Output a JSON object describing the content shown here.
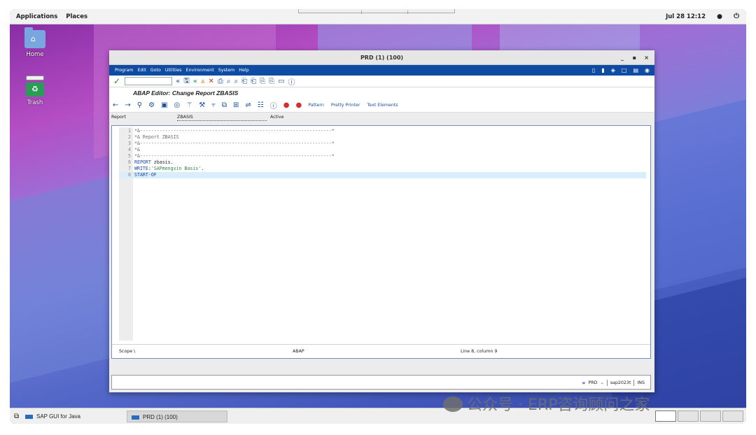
{
  "topbar": {
    "applications": "Applications",
    "places": "Places",
    "clock": "Jul 28 12:12",
    "dot": "●",
    "power": "⏻"
  },
  "desktop": {
    "home_label": "Home",
    "trash_label": "Trash"
  },
  "window": {
    "title": "PRD (1) (100)",
    "controls": {
      "minimize": "_",
      "maximize": "▪",
      "close": "×"
    },
    "menu": [
      "Program",
      "Edit",
      "Goto",
      "Utilities",
      "Environment",
      "System",
      "Help"
    ],
    "heading": "ABAP Editor: Change Report ZBASIS",
    "toolbar_text_buttons": {
      "pattern": "Pattern",
      "pretty_printer": "Pretty Printer",
      "text_elements": "Text Elements"
    },
    "report_row": {
      "label": "Report",
      "name": "ZBASIS",
      "status": "Active"
    },
    "code_lines": [
      {
        "n": "1",
        "text": "*&---------------------------------------------------------------------*"
      },
      {
        "n": "2",
        "text": "*& Report ZBASIS"
      },
      {
        "n": "3",
        "text": "*&---------------------------------------------------------------------*"
      },
      {
        "n": "4",
        "text": "*&"
      },
      {
        "n": "5",
        "text": "*&---------------------------------------------------------------------*"
      },
      {
        "n": "6",
        "kw": "REPORT",
        "rest": " zbasis."
      },
      {
        "n": "7",
        "kw": "WRITE",
        "rest": ":",
        "str": "'SAPmengxin Basis'",
        "tail": "."
      },
      {
        "n": "8",
        "kw": "START-OF",
        "rest": ""
      }
    ],
    "editor_status": {
      "scope": "Scope \\",
      "language": "ABAP",
      "cursor": "Line 8, column 9"
    },
    "sap_status": {
      "system": "PRD",
      "server": "sap2023t",
      "mode": "INS"
    }
  },
  "taskbar": {
    "task1": "SAP GUI for Java",
    "task2": "PRD (1) (100)"
  },
  "watermark": "公众号 · ERP咨询顾问之家"
}
